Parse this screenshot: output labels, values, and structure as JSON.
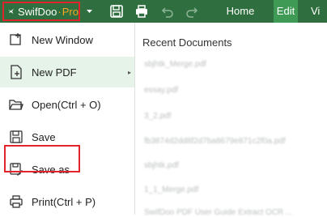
{
  "brand": {
    "name": "SwifDoo",
    "separator": "·",
    "edition": "Pro"
  },
  "icons": {
    "logo": "bird-logo-icon",
    "dropdown": "caret-down-icon",
    "save": "floppy-disk-icon",
    "print": "printer-icon",
    "undo": "undo-icon",
    "redo": "redo-icon"
  },
  "tabs": [
    {
      "label": "Home",
      "active": false
    },
    {
      "label": "Edit",
      "active": true
    },
    {
      "label": "Vi",
      "active": false
    }
  ],
  "menu": [
    {
      "label": "New Window",
      "icon": "new-window-icon"
    },
    {
      "label": "New PDF",
      "icon": "new-pdf-icon",
      "submenu": "▸"
    },
    {
      "label": "Open(Ctrl + O)",
      "icon": "open-folder-icon"
    },
    {
      "label": "Save",
      "icon": "save-icon"
    },
    {
      "label": "Save as",
      "icon": "save-as-icon"
    },
    {
      "label": "Print(Ctrl + P)",
      "icon": "print-icon"
    }
  ],
  "recent": {
    "title": "Recent Documents",
    "items": [
      "sbjhtk_Merge.pdf",
      "essay.pdf",
      "3_2.pdf",
      "fb3874d2dd8f2d7ba8679e871c2f0a.pdf",
      "sbjhtk.pdf",
      "1_1_Merge.pdf",
      "SwifDoo PDF User Guide Extract OCR ..."
    ]
  },
  "colors": {
    "toolbar_bg": "#2f6e3e",
    "active_tab_bg": "#3f9a55",
    "highlight_outline": "#e0242b",
    "pro_text": "#f5a623",
    "menu_hover_bg": "#e5f3e8"
  }
}
